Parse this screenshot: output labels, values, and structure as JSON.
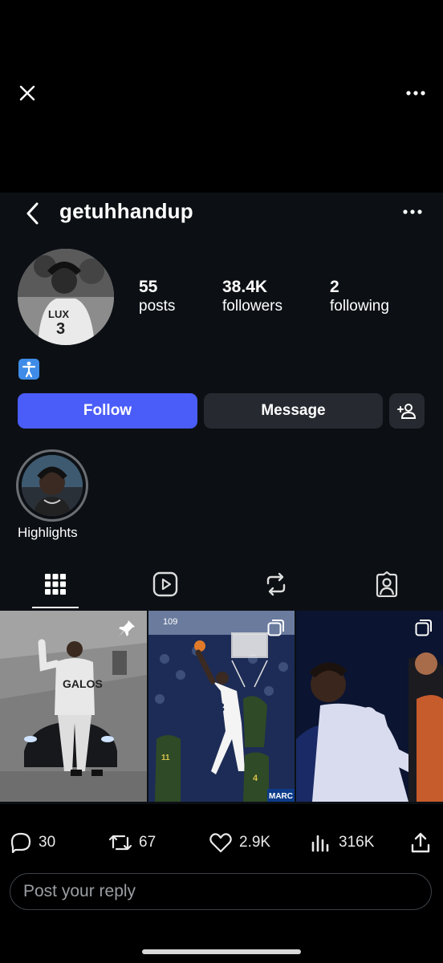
{
  "viewer": {
    "close_icon": "close-icon",
    "more_icon": "more-horizontal-icon"
  },
  "profile": {
    "username": "getuhhandup",
    "stats": [
      {
        "value": "55",
        "label": "posts"
      },
      {
        "value": "38.4K",
        "label": "followers"
      },
      {
        "value": "2",
        "label": "following"
      }
    ],
    "bio_icon": "person-standing-icon",
    "buttons": {
      "follow": "Follow",
      "message": "Message"
    },
    "highlight_label": "Highlights",
    "tabs": [
      "grid-icon",
      "reels-icon",
      "reposts-icon",
      "tagged-icon"
    ],
    "grid_overlays": {
      "cell1_text": "GALOS",
      "cell2_text": "109",
      "cell2_jersey": "3",
      "cell2_jersey_b": "11",
      "cell2_jersey_c": "4",
      "cell2_banner": "MARC"
    },
    "accent_color": "#4a5df9"
  },
  "tweet_actions": {
    "replies": "30",
    "reposts": "67",
    "likes": "2.9K",
    "views": "316K"
  },
  "reply_placeholder": "Post your reply"
}
